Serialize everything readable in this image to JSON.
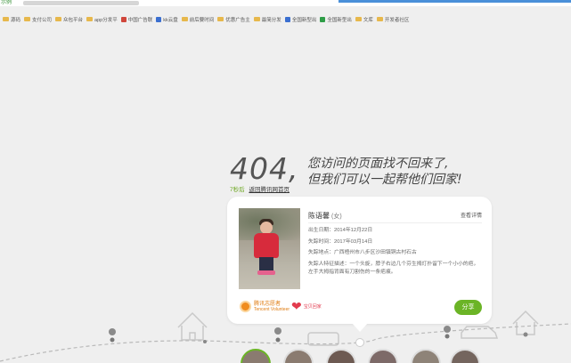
{
  "browser": {
    "url_fragment": "示例",
    "bookmarks": [
      {
        "label": "源码",
        "icon": "folder"
      },
      {
        "label": "支付公司",
        "icon": "folder"
      },
      {
        "label": "众包平台",
        "icon": "folder"
      },
      {
        "label": "app分发平",
        "icon": "folder"
      },
      {
        "label": "中国广告联",
        "icon": "site"
      },
      {
        "label": "kk云盘",
        "icon": "site"
      },
      {
        "label": "前后要时间",
        "icon": "folder"
      },
      {
        "label": "优惠广告主",
        "icon": "folder"
      },
      {
        "label": "最简分发",
        "icon": "folder"
      },
      {
        "label": "全国新型出",
        "icon": "site"
      },
      {
        "label": "全国新型出",
        "icon": "site"
      },
      {
        "label": "文库",
        "icon": "folder"
      },
      {
        "label": "开发者社区",
        "icon": "folder"
      }
    ]
  },
  "error": {
    "code": "404,",
    "message_line1": "您访问的页面找不回来了,",
    "message_line2": "但我们可以一起帮他们回家!",
    "countdown": "7秒后",
    "return_link": "返回腾讯网首页"
  },
  "card": {
    "name": "陈语馨",
    "gender": "(女)",
    "details_link": "查看详情",
    "birth": "出生日期：2014年12月22日",
    "missing_time": "失踪时间：2017年03月14日",
    "missing_place": "失踪地点：广西梧州市八步区沙田镇铜古村石古",
    "features": "失踪人特征描述：一个头旋，脖子右边几个芬生拇灯扑留下一个小小的疤，左手大拇指背面有刀割伤的一条疤痕。",
    "org1_name": "腾讯志愿者",
    "org1_sub": "Tencent Volunteer",
    "org2_name": "宝贝回家",
    "share_button": "分享"
  },
  "colors": {
    "accent_green": "#6bb426",
    "background": "#efefef"
  }
}
